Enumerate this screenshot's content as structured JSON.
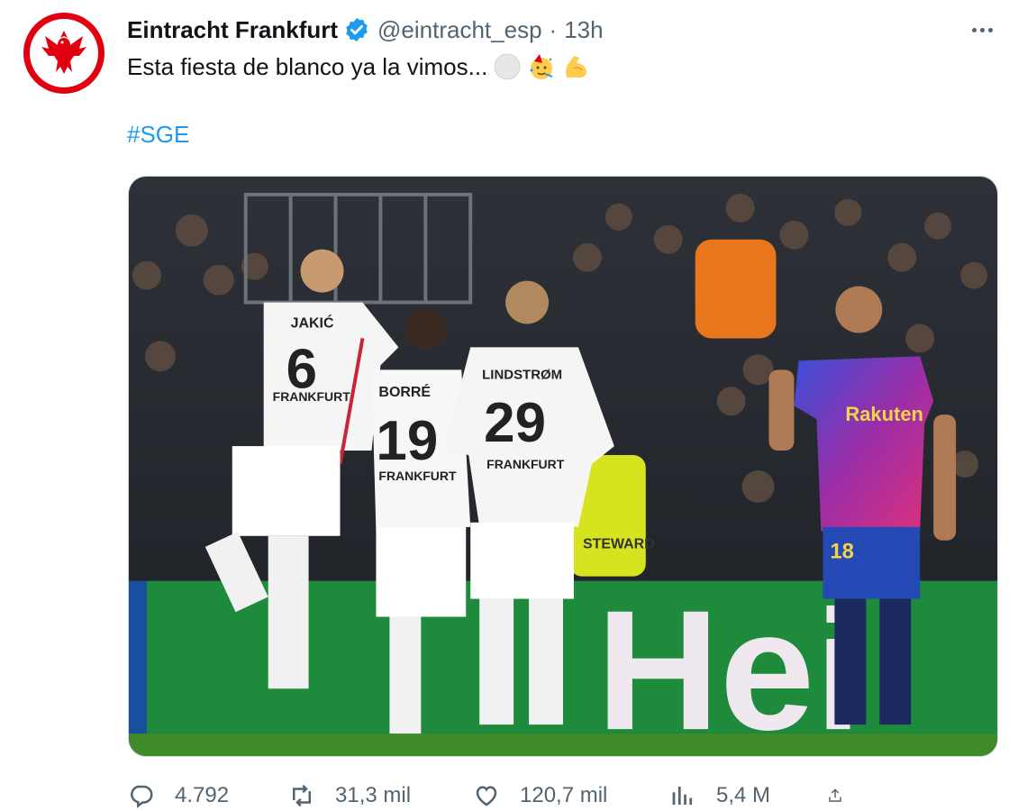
{
  "colors": {
    "club_red": "#e1000f",
    "verified_blue": "#1d9bf0",
    "secondary_text": "#536471",
    "hashtag": "#1d9bf0"
  },
  "tweet": {
    "author": {
      "display_name": "Eintracht Frankfurt",
      "verified_icon": "verified-badge-icon",
      "handle": "@eintracht_esp",
      "separator": "·",
      "time": "13h",
      "avatar_icon": "eagle-crest-icon"
    },
    "more_icon": "more-dots-icon",
    "text": "Esta fiesta de blanco ya la vimos...",
    "emojis": [
      "white-circle-emoji",
      "partying-face-emoji",
      "flexed-biceps-emoji"
    ],
    "hashtag": "#SGE",
    "media": {
      "players": [
        {
          "name": "JAKIĆ",
          "number": "6",
          "club": "FRANKFURT"
        },
        {
          "name": "BORRÉ",
          "number": "19",
          "club": "FRANKFURT"
        },
        {
          "name": "LINDSTRØM",
          "number": "29",
          "club": "FRANKFURT"
        },
        {
          "sponsor": "Rakuten",
          "number": "18"
        }
      ],
      "board_text": "Hei",
      "steward_text": "STEWARD"
    },
    "actions": {
      "reply": {
        "icon": "reply-icon",
        "count": "4.792"
      },
      "retweet": {
        "icon": "retweet-icon",
        "count": "31,3 mil"
      },
      "like": {
        "icon": "heart-icon",
        "count": "120,7 mil"
      },
      "views": {
        "icon": "views-chart-icon",
        "count": "5,4 M"
      },
      "share": {
        "icon": "share-icon"
      }
    }
  }
}
